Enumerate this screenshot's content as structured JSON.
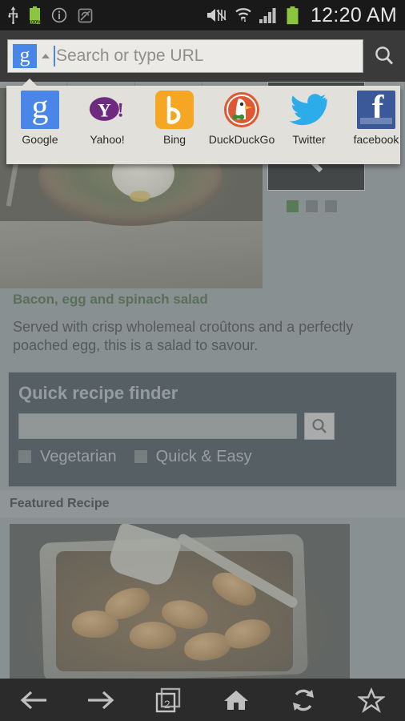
{
  "statusbar": {
    "time": "12:20 AM",
    "battery_percent": "100%",
    "left_icons": [
      "usb-icon",
      "battery-icon",
      "info-icon",
      "sync-disabled-icon"
    ],
    "right_icons": [
      "mute-vibrate-icon",
      "wifi-icon",
      "signal-icon",
      "battery-icon"
    ]
  },
  "urlbar": {
    "engine_letter": "g",
    "placeholder": "Search or type URL",
    "value": "",
    "search_icon": "search-icon",
    "dropdown_icon": "caret-up-icon"
  },
  "engine_popup": {
    "engines": [
      {
        "name": "Google",
        "icon": "google-icon",
        "letter": "g"
      },
      {
        "name": "Yahoo!",
        "icon": "yahoo-icon",
        "letter": "Y!"
      },
      {
        "name": "Bing",
        "icon": "bing-icon",
        "letter": "b"
      },
      {
        "name": "DuckDuckGo",
        "icon": "duckduckgo-icon",
        "letter": ""
      },
      {
        "name": "Twitter",
        "icon": "twitter-icon",
        "letter": ""
      },
      {
        "name": "facebook",
        "icon": "facebook-icon",
        "letter": "f"
      }
    ]
  },
  "webpage": {
    "carousel": {
      "next_label": "›",
      "prev_label": "‹",
      "dots": 3,
      "active_dot": 1
    },
    "hero": {
      "title": "Bacon, egg and spinach salad",
      "description": "Served with crisp wholemeal croûtons and a perfectly poached egg, this is a salad to savour."
    },
    "finder": {
      "heading": "Quick recipe finder",
      "input_value": "",
      "input_placeholder": "",
      "search_icon": "search-icon",
      "checkboxes": [
        {
          "label": "Vegetarian",
          "checked": false
        },
        {
          "label": "Quick & Easy",
          "checked": false
        }
      ]
    },
    "featured": {
      "heading": "Featured Recipe"
    }
  },
  "navbar": {
    "buttons": [
      {
        "name": "back-button",
        "icon": "arrow-left-icon"
      },
      {
        "name": "forward-button",
        "icon": "arrow-right-icon"
      },
      {
        "name": "tabs-button",
        "icon": "tabs-icon",
        "count": "2"
      },
      {
        "name": "home-button",
        "icon": "home-icon"
      },
      {
        "name": "reload-button",
        "icon": "refresh-icon"
      },
      {
        "name": "bookmark-button",
        "icon": "star-icon"
      }
    ]
  },
  "colors": {
    "status_bar": "#191919",
    "url_bar": "#3a3a3a",
    "page_bg": "#7e8688",
    "finder_bg": "#222c36",
    "accent_green": "#246022",
    "title_green": "#2b4724",
    "google_blue": "#4a86e8",
    "nav_bar": "#2b2b2b"
  }
}
